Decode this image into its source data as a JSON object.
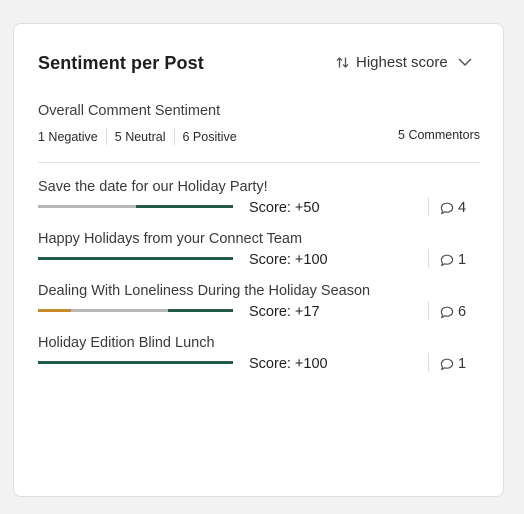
{
  "widget": {
    "title": "Sentiment per Post",
    "sort": {
      "label": "Highest score",
      "icon": "sort-arrows-icon",
      "dropdown_icon": "chevron-down-icon"
    }
  },
  "overall": {
    "title": "Overall Comment Sentiment",
    "negative": "1 Negative",
    "neutral": "5 Neutral",
    "positive": "6 Positive",
    "commentors": "5 Commentors"
  },
  "colors": {
    "negative": "#c98a2e",
    "neutral": "#b8b8b8",
    "positive": "#215a4a"
  },
  "posts": [
    {
      "title": "Save the date for our Holiday Party!",
      "score": "Score: +50",
      "comments": "4",
      "sentiment": {
        "negative": 0,
        "neutral": 0.5,
        "positive": 0.5
      }
    },
    {
      "title": "Happy Holidays from your Connect Team",
      "score": "Score: +100",
      "comments": "1",
      "sentiment": {
        "negative": 0,
        "neutral": 0,
        "positive": 1
      }
    },
    {
      "title": "Dealing With Loneliness During the Holiday Season",
      "score": "Score: +17",
      "comments": "6",
      "sentiment": {
        "negative": 0.1667,
        "neutral": 0.5,
        "positive": 0.3333
      }
    },
    {
      "title": "Holiday Edition Blind Lunch",
      "score": "Score: +100",
      "comments": "1",
      "sentiment": {
        "negative": 0,
        "neutral": 0,
        "positive": 1
      }
    }
  ]
}
